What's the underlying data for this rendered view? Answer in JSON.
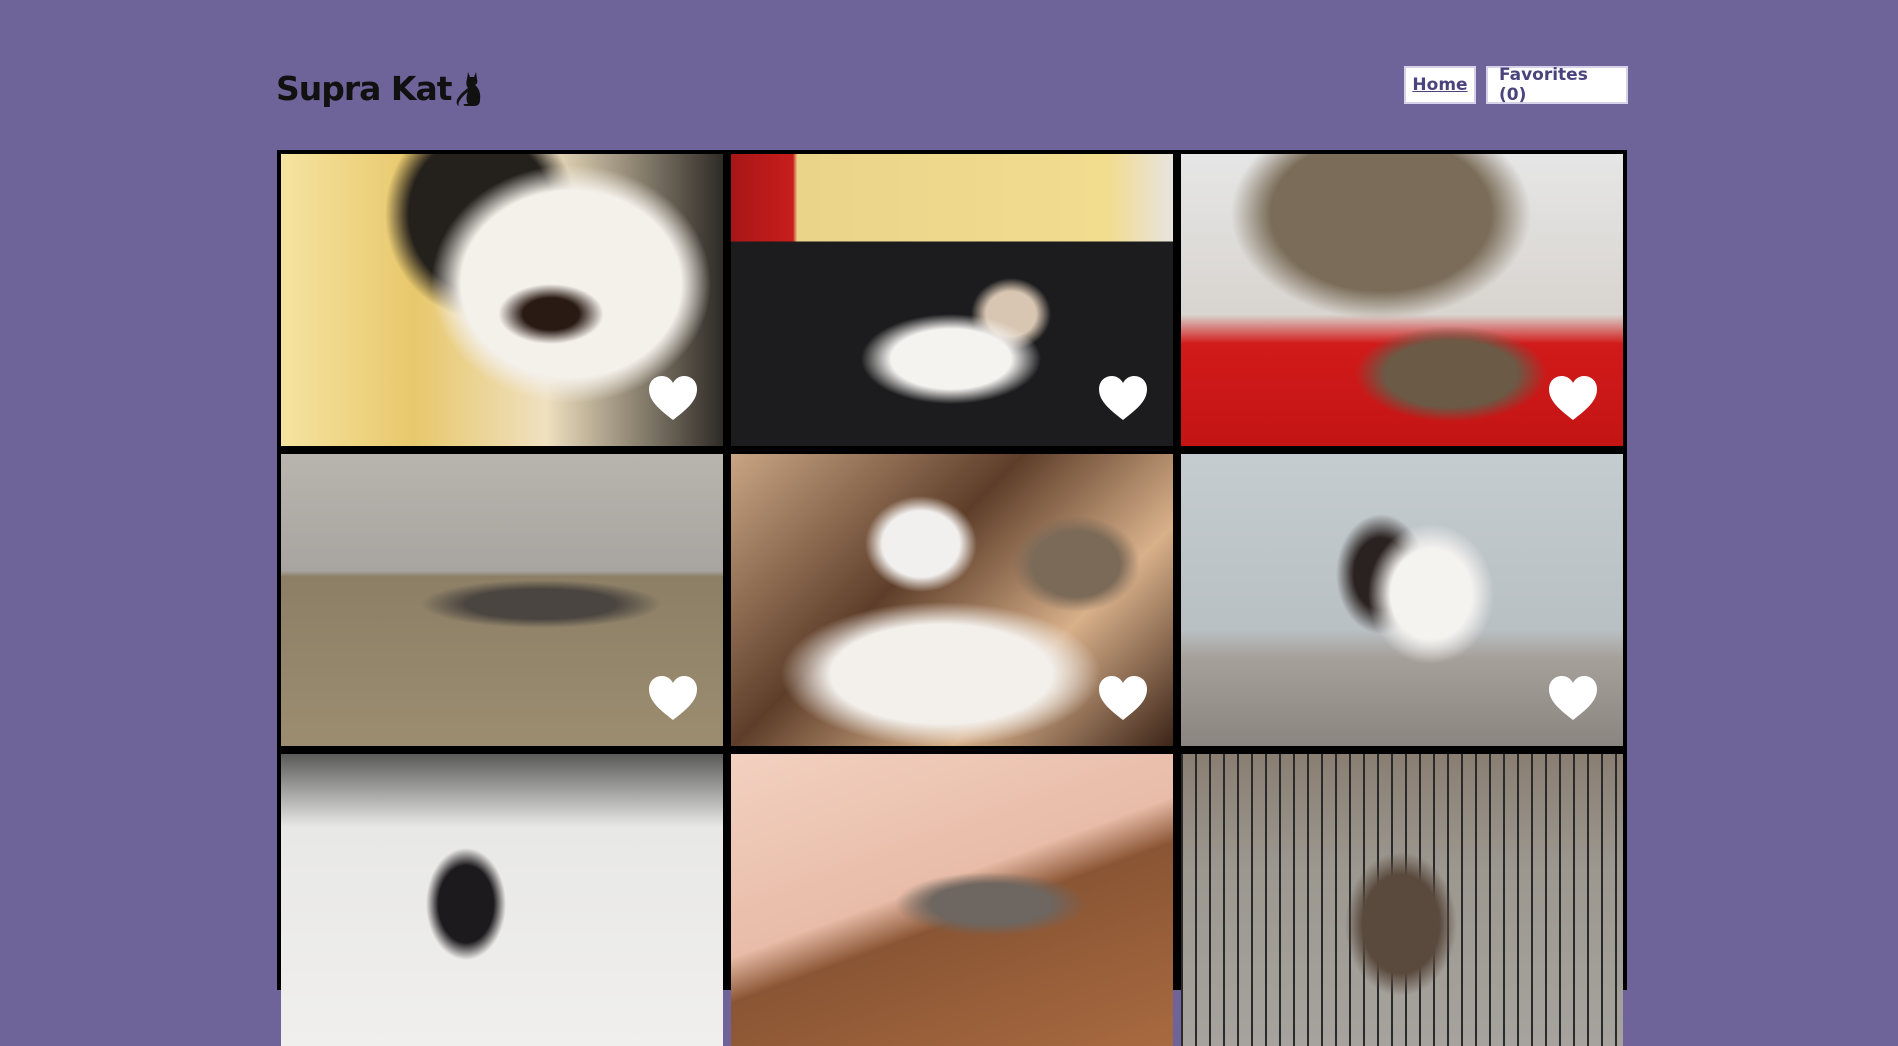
{
  "header": {
    "logo_text": "Supra Kat",
    "logo_icon": "cat-silhouette-icon"
  },
  "nav": {
    "home_label": "Home",
    "favorites_label": "Favorites (0)"
  },
  "gallery": {
    "heart_icon": "heart-icon",
    "heart_color": "#ffffff",
    "frame_color": "#000000"
  },
  "colors": {
    "page_background": "#6e6499",
    "nav_text": "#4b437c"
  }
}
